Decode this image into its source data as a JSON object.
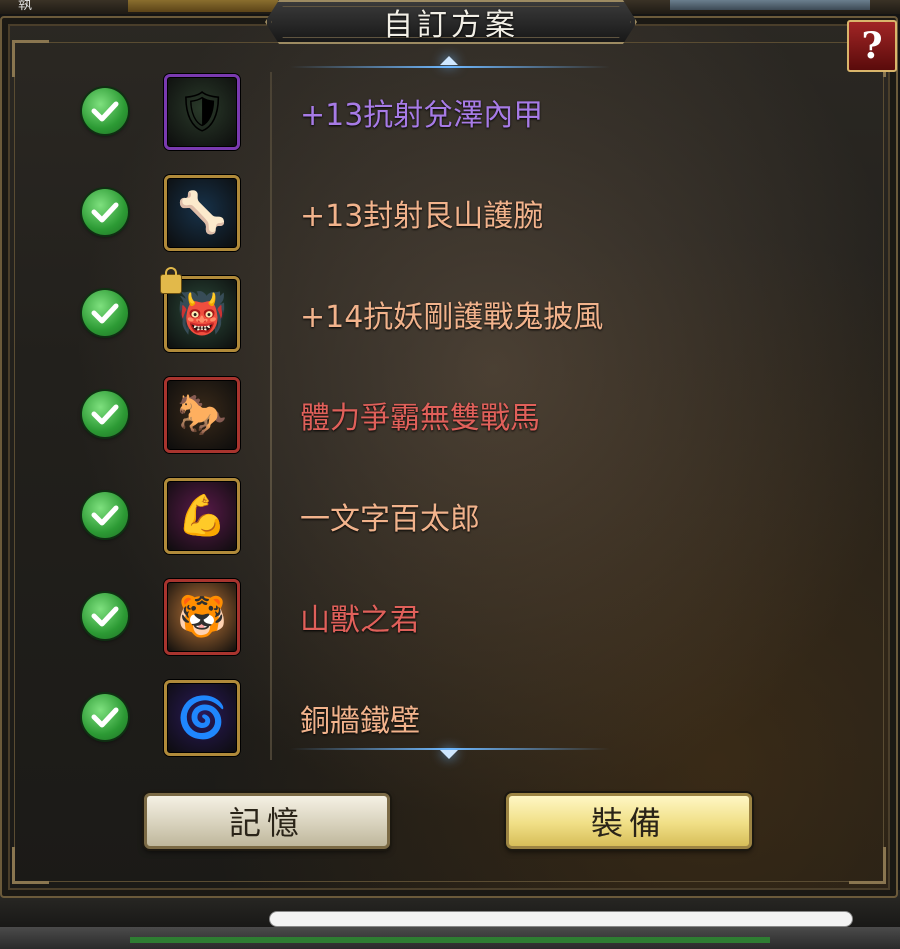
{
  "backdrop": {
    "top_left_label": "執"
  },
  "dialog": {
    "title": "自訂方案",
    "help_label": "?"
  },
  "items": [
    {
      "name": "+13抗射兌澤內甲",
      "color": "#a77be6",
      "icon": "armor-vest-icon",
      "glyph": "🛡",
      "frame": "#7a3ab0",
      "bg": "#2a3a2a",
      "checked": true,
      "locked": false
    },
    {
      "name": "+13封射艮山護腕",
      "color": "#f2b38c",
      "icon": "bracer-icon",
      "glyph": "🦴",
      "frame": "#b08a3a",
      "bg": "#17324a",
      "checked": true,
      "locked": false
    },
    {
      "name": "+14抗妖剛護戰鬼披風",
      "color": "#f2b38c",
      "icon": "ghost-cloak-icon",
      "glyph": "👹",
      "frame": "#b08a3a",
      "bg": "#2b4a3a",
      "checked": true,
      "locked": true
    },
    {
      "name": "體力爭霸無雙戰馬",
      "color": "#e0605a",
      "icon": "war-horse-icon",
      "glyph": "🐎",
      "frame": "#a8342e",
      "bg": "#3a2a1a",
      "checked": true,
      "locked": false
    },
    {
      "name": "一文字百太郎",
      "color": "#f2b38c",
      "icon": "warrior-portrait-icon",
      "glyph": "💪",
      "frame": "#b08a3a",
      "bg": "#5a1a4a",
      "checked": true,
      "locked": false
    },
    {
      "name": "山獸之君",
      "color": "#e0605a",
      "icon": "tiger-icon",
      "glyph": "🐯",
      "frame": "#a8342e",
      "bg": "#c27a3a",
      "checked": true,
      "locked": false
    },
    {
      "name": "銅牆鐵壁",
      "color": "#f2b38c",
      "icon": "dark-vortex-icon",
      "glyph": "🌀",
      "frame": "#b08a3a",
      "bg": "#2a1a5a",
      "checked": true,
      "locked": false
    }
  ],
  "buttons": {
    "memory": "記憶",
    "equip": "裝備"
  }
}
